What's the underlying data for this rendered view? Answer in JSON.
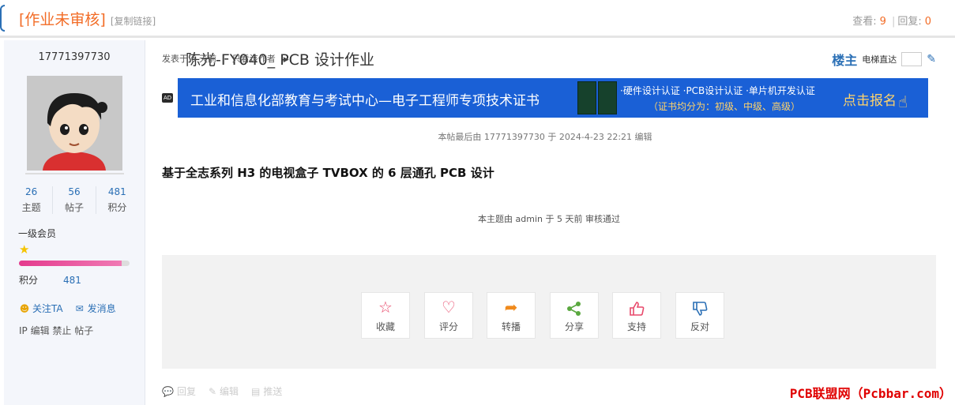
{
  "title": {
    "tag": "[作业未审核]",
    "main": "陈光-FY040_ PCB 设计作业",
    "copy_link": "[复制链接]"
  },
  "stats": {
    "views_label": "查看:",
    "views": "9",
    "replies_label": "回复:",
    "replies": "0"
  },
  "user": {
    "name": "17771397730",
    "stats": [
      {
        "value": "26",
        "label": "主题"
      },
      {
        "value": "56",
        "label": "帖子"
      },
      {
        "value": "481",
        "label": "积分"
      }
    ],
    "level": "一级会员",
    "level_progress": 0.93,
    "points_label": "积分",
    "points_value": "481",
    "follow": "关注TA",
    "message": "发消息",
    "ip_line": "IP 编辑 禁止 帖子"
  },
  "post": {
    "posted": "发表于 6 天前",
    "only_author": "只看该作者",
    "floor": "楼主",
    "jump": "电梯直达",
    "ad_tag": "AD",
    "banner": {
      "title": "工业和信息化部教育与考试中心—电子工程师专项技术证书",
      "line1": "·硬件设计认证 ·PCB设计认证 ·单片机开发认证",
      "line2": "（证书均分为：初级、中级、高级）",
      "cta": "点击报名"
    },
    "edited": "本帖最后由 17771397730 于 2024-4-23 22:21 编辑",
    "heading": "基于全志系列 H3 的电视盒子 TVBOX 的 6 层通孔 PCB 设计",
    "reviewed": "本主题由 admin 于 5 天前 审核通过"
  },
  "action_buttons": [
    {
      "label": "收藏",
      "icon": "star-icon",
      "color": "#e8496b"
    },
    {
      "label": "评分",
      "icon": "heart-icon",
      "color": "#e8496b"
    },
    {
      "label": "转播",
      "icon": "share-arrow-icon",
      "color": "#f08a1c"
    },
    {
      "label": "分享",
      "icon": "share-nodes-icon",
      "color": "#5aa83f"
    },
    {
      "label": "支持",
      "icon": "thumbs-up-icon",
      "color": "#e8496b"
    },
    {
      "label": "反对",
      "icon": "thumbs-down-icon",
      "color": "#2a6fb5"
    }
  ],
  "footer": {
    "reply": "回复",
    "edit": "编辑",
    "push": "推送"
  },
  "watermark": "PCB联盟网（Pcbbar.com）"
}
